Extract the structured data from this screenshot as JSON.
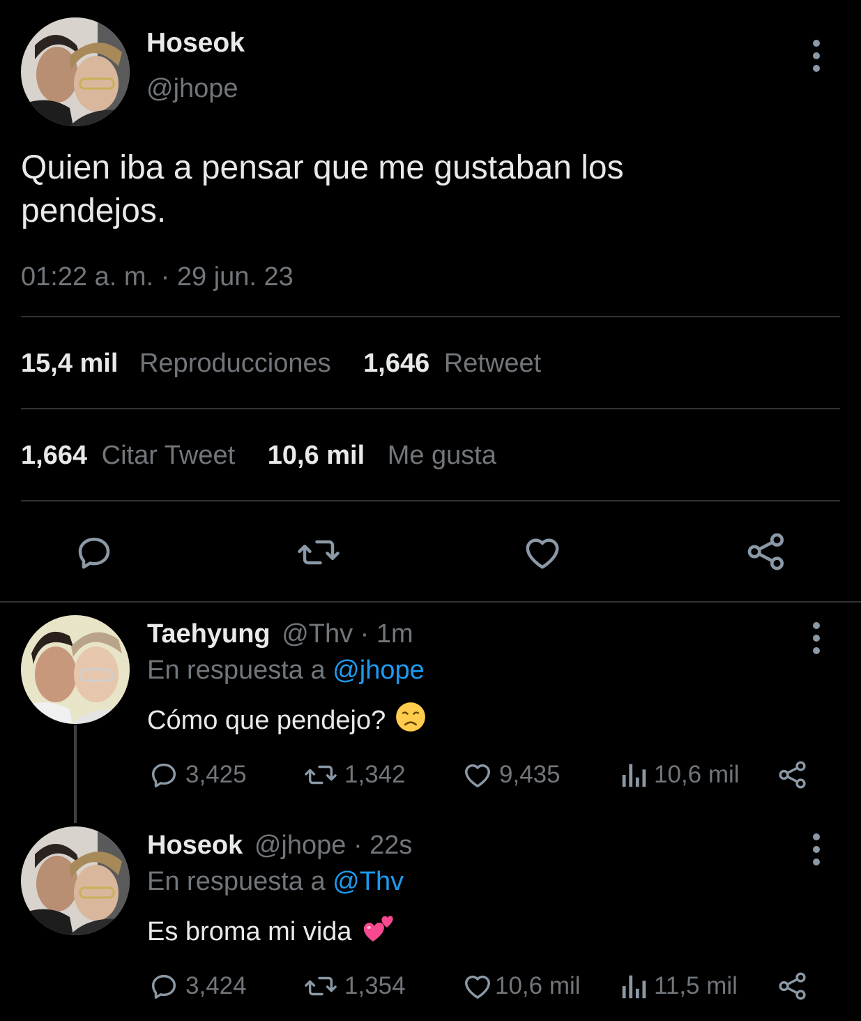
{
  "main_tweet": {
    "display_name": "Hoseok",
    "handle": "@jhope",
    "text_line1": "Quien iba a pensar que me gustaban los",
    "text_line2": "pendejos.",
    "timestamp": "01:22 a. m. · 29 jun. 23",
    "views_count": "15,4 mil",
    "views_label": "Reproducciones",
    "retweets_count": "1,646",
    "retweets_label": "Retweet",
    "quotes_count": "1,664",
    "quotes_label": "Citar Tweet",
    "likes_count": "10,6 mil",
    "likes_label": "Me gusta"
  },
  "replies": [
    {
      "display_name": "Taehyung",
      "meta": "@Thv · 1m",
      "reply_prefix": "En respuesta a",
      "reply_to": "@jhope",
      "text": "Cómo que pendejo?",
      "emoji": "disappointed-face",
      "replies": "3,425",
      "retweets": "1,342",
      "likes": "9,435",
      "views": "10,6 mil"
    },
    {
      "display_name": "Hoseok",
      "meta": "@jhope · 22s",
      "reply_prefix": "En respuesta a",
      "reply_to": "@Thv",
      "text": "Es broma mi vida",
      "emoji": "two-hearts",
      "replies": "3,424",
      "retweets": "1,354",
      "likes": "10,6 mil",
      "views": "11,5 mil"
    }
  ],
  "colors": {
    "background": "#000000",
    "text": "#e7e9ea",
    "muted": "#71767b",
    "link": "#1d9bf0",
    "divider": "#2f3336"
  }
}
